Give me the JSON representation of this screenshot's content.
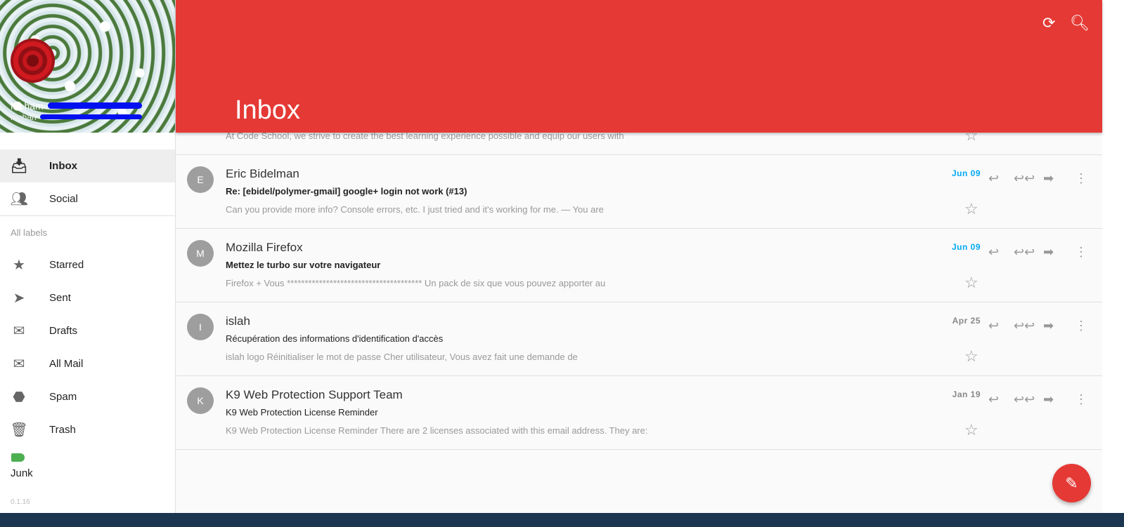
{
  "profile": {
    "name": "Moham",
    "email": "mohan"
  },
  "header": {
    "title": "Inbox",
    "refresh_icon": "refresh-icon",
    "search_icon": "search-icon"
  },
  "nav": [
    {
      "label": "Inbox",
      "icon": "inbox-icon"
    },
    {
      "label": "Social",
      "icon": "people-icon"
    }
  ],
  "labels_heading": "All labels",
  "labels": [
    {
      "label": "Starred",
      "icon": "star-icon"
    },
    {
      "label": "Sent",
      "icon": "send-icon"
    },
    {
      "label": "Drafts",
      "icon": "drafts-icon"
    },
    {
      "label": "All Mail",
      "icon": "mail-icon"
    },
    {
      "label": "Spam",
      "icon": "report-icon"
    },
    {
      "label": "Trash",
      "icon": "trash-icon"
    }
  ],
  "custom_label": {
    "label": "Junk",
    "color": "#4caf50"
  },
  "version": "0.1.16",
  "accent": "#e53935",
  "partial_snippet": "At Code School, we strive to create the best learning experience possible and equip our users with",
  "emails": [
    {
      "initial": "E",
      "from": "Eric Bidelman",
      "subject": "Re: [ebidel/polymer-gmail] google+ login not work (#13)",
      "snippet": "Can you provide more info? Console errors, etc. I just tried and it's working for me. — You are",
      "date": "Jun 09",
      "unread": true
    },
    {
      "initial": "M",
      "from": "Mozilla Firefox",
      "subject": "Mettez le turbo sur votre navigateur",
      "snippet": "Firefox + Vous ************************************** Un pack de six que vous pouvez apporter au",
      "date": "Jun 09",
      "unread": true
    },
    {
      "initial": "I",
      "from": "islah",
      "subject": "Récupération des informations d'identification d'accès",
      "snippet": "islah logo Réinitialiser le mot de passe Cher utilisateur, Vous avez fait une demande de",
      "date": "Apr 25",
      "unread": false
    },
    {
      "initial": "K",
      "from": "K9 Web Protection Support Team",
      "subject": "K9 Web Protection License Reminder",
      "snippet": "K9 Web Protection License Reminder There are 2 licenses associated with this email address. They are:",
      "date": "Jan 19",
      "unread": false
    }
  ]
}
